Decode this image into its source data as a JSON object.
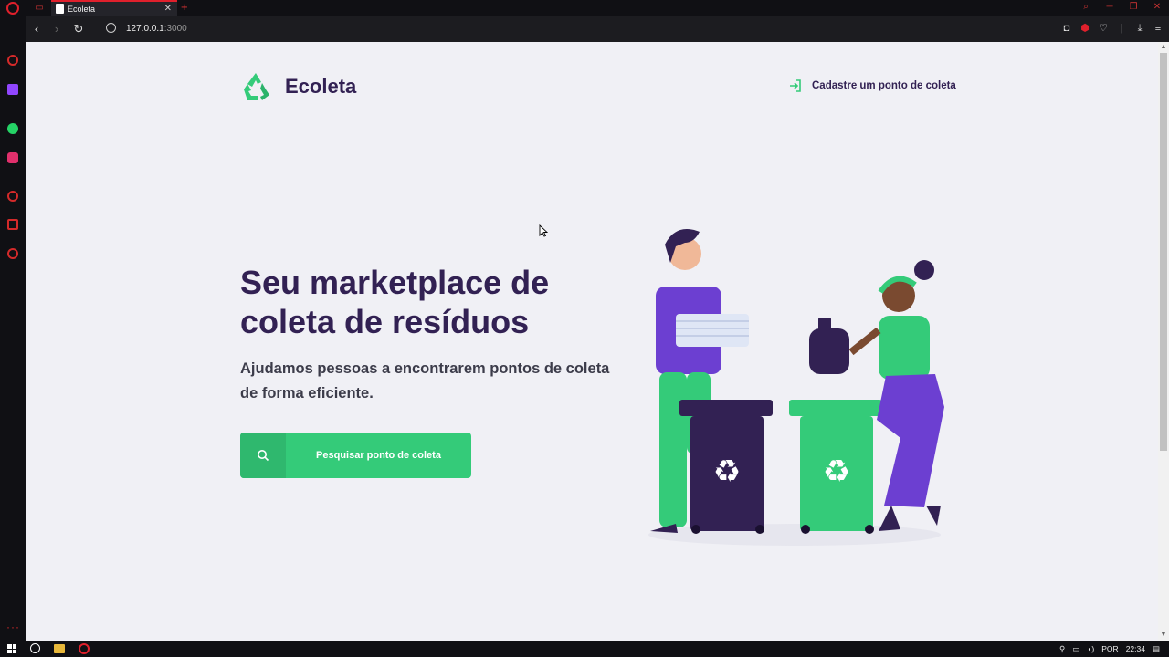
{
  "browser": {
    "tab_title": "Ecoleta",
    "tab_close": "✕",
    "new_tab": "+",
    "url_host": "127.0.0.1",
    "url_port": ":3000"
  },
  "page": {
    "brand": "Ecoleta",
    "header_link": "Cadastre um ponto de coleta",
    "title_line1": "Seu marketplace de",
    "title_line2": "coleta de resíduos",
    "subtitle_line1": "Ajudamos pessoas a encontrarem pontos de coleta",
    "subtitle_line2": "de forma eficiente.",
    "search_button": "Pesquisar ponto de coleta"
  },
  "taskbar": {
    "language": "POR",
    "time": "22:34"
  },
  "colors": {
    "primary": "#34cb79",
    "title": "#322153",
    "background": "#f0f0f5",
    "purple": "#6c3fd1",
    "dark_purple": "#322153"
  },
  "icons": [
    "recycle-icon",
    "sign-in-icon",
    "search-icon",
    "globe-icon",
    "back-icon",
    "forward-icon",
    "reload-icon"
  ]
}
